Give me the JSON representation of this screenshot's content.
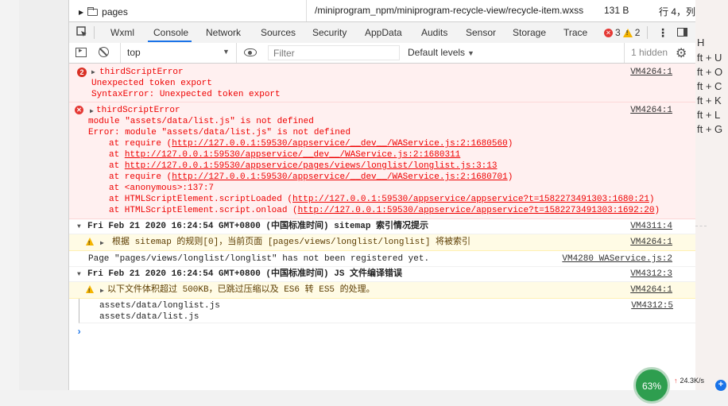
{
  "filerow": {
    "folder": "pages",
    "path": "/miniprogram_npm/miniprogram-recycle-view/recycle-item.wxss",
    "size": "131 B",
    "line": "行 4，列"
  },
  "tabs": [
    "Wxml",
    "Console",
    "Network",
    "Sources",
    "Security",
    "AppData",
    "Audits",
    "Sensor",
    "Storage",
    "Trace"
  ],
  "active_tab": "Console",
  "badges": {
    "errors": "3",
    "warnings": "2"
  },
  "toolbar": {
    "context": "top",
    "filter_placeholder": "Filter",
    "levels": "Default levels",
    "hidden": "1 hidden"
  },
  "console": {
    "entry1": {
      "count": "2",
      "title": "thirdScriptError",
      "line1": "Unexpected token export",
      "line2": "SyntaxError: Unexpected token export",
      "source": "VM4264:1"
    },
    "entry2": {
      "title": "thirdScriptError",
      "line1": "module \"assets/data/list.js\" is not defined",
      "line2": "Error: module \"assets/data/list.js\" is not defined",
      "source": "VM4264:1",
      "stack": [
        {
          "pre": "at require (",
          "link": "http://127.0.0.1:59530/appservice/__dev__/WAService.js:2:1680560",
          "post": ")"
        },
        {
          "pre": "at ",
          "link": "http://127.0.0.1:59530/appservice/__dev__/WAService.js:2:1680311",
          "post": ""
        },
        {
          "pre": "at ",
          "link": "http://127.0.0.1:59530/appservice/pages/views/longlist/longlist.js:3:13",
          "post": ""
        },
        {
          "pre": "at require (",
          "link": "http://127.0.0.1:59530/appservice/__dev__/WAService.js:2:1680701",
          "post": ")"
        },
        {
          "pre": "at <anonymous>:137:7",
          "link": "",
          "post": ""
        },
        {
          "pre": "at HTMLScriptElement.scriptLoaded (",
          "link": "http://127.0.0.1:59530/appservice/appservice?t=1582273491303:1680:21",
          "post": ")"
        },
        {
          "pre": "at HTMLScriptElement.script.onload (",
          "link": "http://127.0.0.1:59530/appservice/appservice?t=1582273491303:1692:20",
          "post": ")"
        }
      ]
    },
    "group1": {
      "title": "Fri Feb 21 2020 16:24:54 GMT+0800 (中国标准时间) sitemap 索引情况提示",
      "source": "VM4311:4"
    },
    "warn1": {
      "text": "根据 sitemap 的规则[0]，当前页面 [pages/views/longlist/longlist] 将被索引",
      "source": "VM4264:1"
    },
    "plain1": {
      "text": "Page \"pages/views/longlist/longlist\" has not been registered yet.",
      "source": "VM4280 WAService.js:2"
    },
    "group2": {
      "title": "Fri Feb 21 2020 16:24:54 GMT+0800 (中国标准时间) JS 文件编译错误",
      "source": "VM4312:3"
    },
    "warn2": {
      "text": "以下文件体积超过 500KB，已跳过压缩以及 ES6 转 ES5 的处理。",
      "source": "VM4264:1"
    },
    "files": {
      "line1": "assets/data/longlist.js",
      "line2": "assets/data/list.js",
      "source": "VM4312:5"
    }
  },
  "right_panel": [
    "H",
    "ft + U",
    "ft + O",
    "ft + C",
    "ft + K",
    "ft + L",
    "ft + G"
  ],
  "widget": {
    "percent": "63%",
    "net_speed": "24.3K/s"
  },
  "colors": {
    "accent": "#1a73e8",
    "error": "#e53935",
    "warning": "#f4b400"
  }
}
